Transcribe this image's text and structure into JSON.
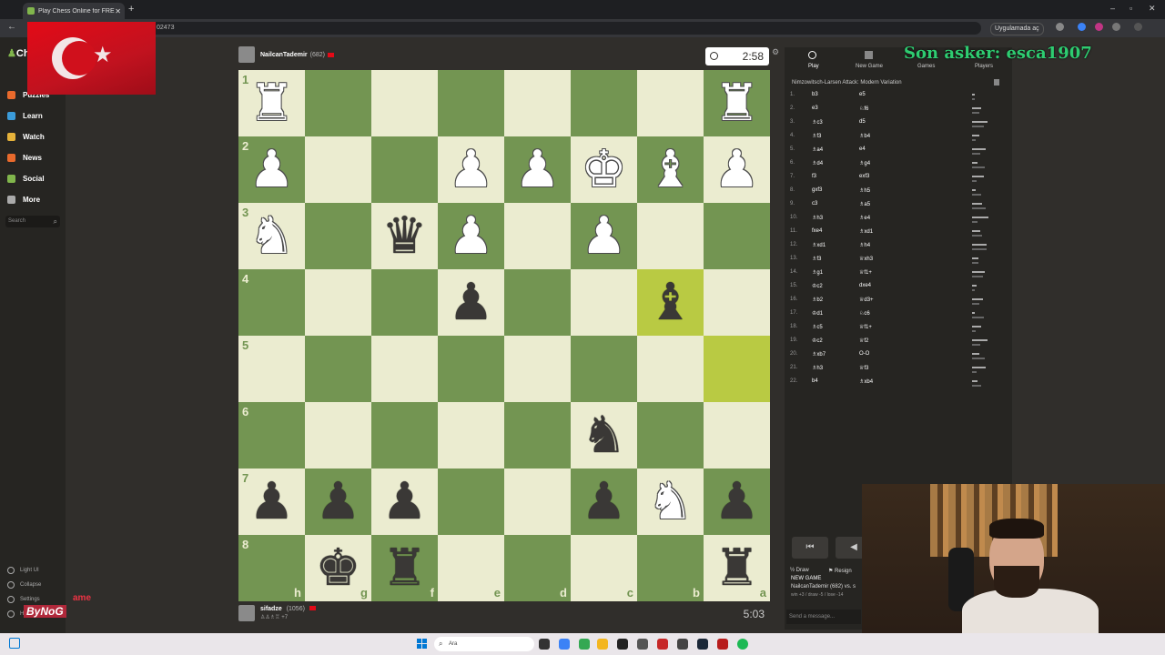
{
  "browser": {
    "tab_title": "Play Chess Online for FREE - 2 ...",
    "url_fragment": "02473",
    "open_in_app": "Uygulamada aç"
  },
  "sidebar": {
    "logo_part1": "Ch",
    "items": [
      {
        "label": "Puzzles",
        "color": "#e96a2c"
      },
      {
        "label": "Learn",
        "color": "#3b9bd9"
      },
      {
        "label": "Watch",
        "color": "#e6b23a"
      },
      {
        "label": "News",
        "color": "#e96a2c"
      },
      {
        "label": "Social",
        "color": "#81b64c"
      },
      {
        "label": "More",
        "color": "#aaaaaa"
      }
    ],
    "search_placeholder": "Search",
    "footer": [
      "Light UI",
      "Collapse",
      "Settings",
      "Help"
    ],
    "brand_watermark": "ByNoG",
    "brand_ame": "ame"
  },
  "top_player": {
    "name": "NailcanTademir",
    "rating": "(682)",
    "clock": "2:58"
  },
  "bottom_player": {
    "name": "sifadze",
    "rating": "(1056)",
    "material": "+7",
    "clock": "5:03"
  },
  "board": {
    "ranks": [
      "1",
      "2",
      "3",
      "4",
      "5",
      "6",
      "7",
      "8"
    ],
    "files": [
      "h",
      "g",
      "f",
      "e",
      "d",
      "c",
      "b",
      "a"
    ],
    "highlighted": [
      "b4",
      "a5"
    ],
    "pieces": [
      {
        "sq": "h1",
        "c": "w",
        "p": "♜"
      },
      {
        "sq": "a1",
        "c": "w",
        "p": "♜"
      },
      {
        "sq": "h2",
        "c": "w",
        "p": "♟"
      },
      {
        "sq": "e2",
        "c": "w",
        "p": "♟"
      },
      {
        "sq": "d2",
        "c": "w",
        "p": "♟"
      },
      {
        "sq": "c2",
        "c": "w",
        "p": "♚"
      },
      {
        "sq": "b2",
        "c": "w",
        "p": "♝"
      },
      {
        "sq": "a2",
        "c": "w",
        "p": "♟"
      },
      {
        "sq": "h3",
        "c": "w",
        "p": "♞"
      },
      {
        "sq": "f3",
        "c": "b",
        "p": "♛"
      },
      {
        "sq": "e3",
        "c": "w",
        "p": "♟"
      },
      {
        "sq": "c3",
        "c": "w",
        "p": "♟"
      },
      {
        "sq": "e4",
        "c": "b",
        "p": "♟"
      },
      {
        "sq": "b4",
        "c": "b",
        "p": "♝"
      },
      {
        "sq": "c6",
        "c": "b",
        "p": "♞"
      },
      {
        "sq": "h7",
        "c": "b",
        "p": "♟"
      },
      {
        "sq": "g7",
        "c": "b",
        "p": "♟"
      },
      {
        "sq": "f7",
        "c": "b",
        "p": "♟"
      },
      {
        "sq": "c7",
        "c": "b",
        "p": "♟"
      },
      {
        "sq": "b7",
        "c": "w",
        "p": "♞"
      },
      {
        "sq": "a7",
        "c": "b",
        "p": "♟"
      },
      {
        "sq": "g8",
        "c": "b",
        "p": "♚"
      },
      {
        "sq": "f8",
        "c": "b",
        "p": "♜"
      },
      {
        "sq": "a8",
        "c": "b",
        "p": "♜"
      }
    ]
  },
  "panel": {
    "tabs": [
      "Play",
      "New Game",
      "Games",
      "Players"
    ],
    "opening": "Nimzowitsch-Larsen Attack: Modern Variation",
    "moves": [
      [
        "1.",
        "b3",
        "e5"
      ],
      [
        "2.",
        "e3",
        "♘f6"
      ],
      [
        "3.",
        "♗c3",
        "d5"
      ],
      [
        "4.",
        "♗f3",
        "♗b4"
      ],
      [
        "5.",
        "♗a4",
        "e4"
      ],
      [
        "6.",
        "♗d4",
        "♗g4"
      ],
      [
        "7.",
        "f3",
        "exf3"
      ],
      [
        "8.",
        "gxf3",
        "♗h5"
      ],
      [
        "9.",
        "c3",
        "♗a5"
      ],
      [
        "10.",
        "♗h3",
        "♗e4"
      ],
      [
        "11.",
        "fxe4",
        "♗xd1"
      ],
      [
        "12.",
        "♗xd1",
        "♗h4"
      ],
      [
        "13.",
        "♗f3",
        "♕xh3"
      ],
      [
        "14.",
        "♗g1",
        "♕f1+"
      ],
      [
        "15.",
        "♔c2",
        "dxe4"
      ],
      [
        "16.",
        "♗b2",
        "♕d3+"
      ],
      [
        "17.",
        "♔d1",
        "♘c6"
      ],
      [
        "18.",
        "♗c5",
        "♕f1+"
      ],
      [
        "19.",
        "♔c2",
        "♕f2"
      ],
      [
        "20.",
        "♗xb7",
        "O-O"
      ],
      [
        "21.",
        "♗h3",
        "♕f3"
      ],
      [
        "22.",
        "b4",
        "♗xb4"
      ]
    ],
    "draw": "Draw",
    "resign": "Resign",
    "new_game_title": "NEW GAME",
    "new_game_line": "NailcanTademir (682) vs. s",
    "new_game_stats": "win +3 / draw -5 / lose -14",
    "message_placeholder": "Send a message..."
  },
  "overlay_text": "Son asker: esca1907",
  "taskbar": {
    "search": "Ara"
  }
}
